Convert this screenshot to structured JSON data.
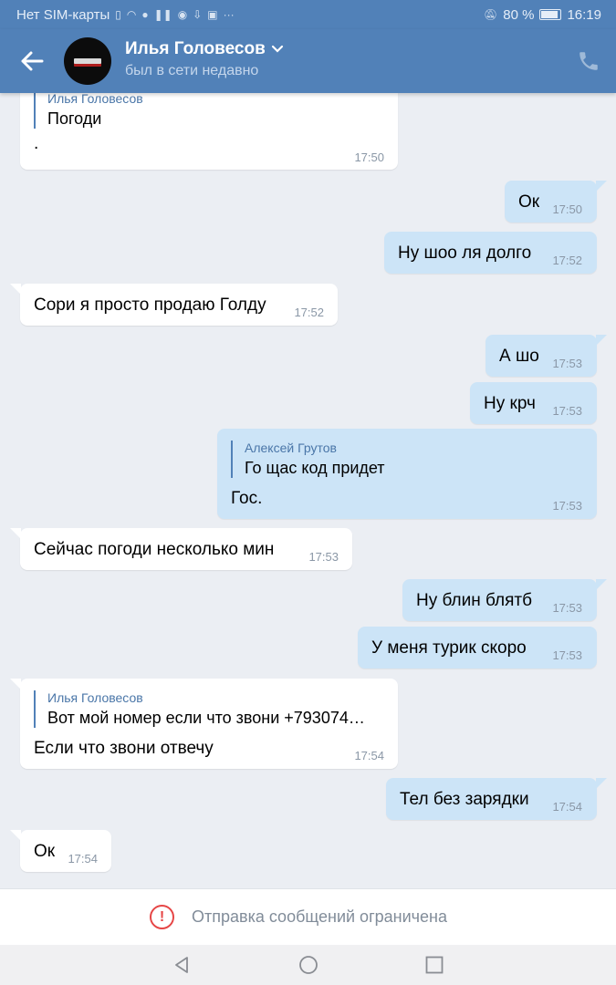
{
  "status_bar": {
    "carrier": "Нет SIM-карты",
    "battery": "80 %",
    "battery_level": 0.8,
    "time": "16:19",
    "icons": [
      "sim-card-icon",
      "wifi-icon",
      "chat-icon",
      "pause-icon",
      "chrome-icon",
      "download-icon",
      "image-icon",
      "more-icon",
      "mute-icon",
      "battery-icon"
    ]
  },
  "header": {
    "name": "Илья Головесов",
    "status": "был в сети недавно",
    "colors": {
      "bar": "#5181b8"
    }
  },
  "messages": [
    {
      "dir": "in",
      "quote": {
        "author": "Илья Головесов",
        "text": "Погоди"
      },
      "text": ".",
      "time": "17:50"
    },
    {
      "dir": "out",
      "text": "Ок",
      "time": "17:50"
    },
    {
      "dir": "out",
      "text": "Ну шоо ля долго",
      "time": "17:52"
    },
    {
      "dir": "in",
      "text": "Сори я просто продаю Голду",
      "time": "17:52"
    },
    {
      "dir": "out",
      "text": "А шо",
      "time": "17:53"
    },
    {
      "dir": "out",
      "text": "Ну крч",
      "time": "17:53"
    },
    {
      "dir": "out",
      "quote": {
        "author": "Алексей Грутов",
        "text": "Го щас код придет"
      },
      "text": "Гос.",
      "time": "17:53"
    },
    {
      "dir": "in",
      "text": "Сейчас погоди несколько мин",
      "time": "17:53"
    },
    {
      "dir": "out",
      "text": "Ну блин блятб",
      "time": "17:53"
    },
    {
      "dir": "out",
      "text": "У меня турик скоро",
      "time": "17:53"
    },
    {
      "dir": "in",
      "quote": {
        "author": "Илья Головесов",
        "text": "Вот мой номер если что звони +793074…"
      },
      "text": "Если что звони отвечу",
      "time": "17:54"
    },
    {
      "dir": "out",
      "text": "Тел без зарядки",
      "time": "17:54"
    },
    {
      "dir": "in",
      "text": "Ок",
      "time": "17:54"
    }
  ],
  "restricted": {
    "text": "Отправка сообщений ограничена",
    "icon": "alert-circle-icon",
    "color": "#e64646"
  },
  "nav": [
    "back-nav-icon",
    "home-nav-icon",
    "recents-nav-icon"
  ],
  "colors": {
    "background": "#ebeef3",
    "incoming": "#ffffff",
    "outgoing": "#cce4f7",
    "accent": "#5181b8"
  }
}
